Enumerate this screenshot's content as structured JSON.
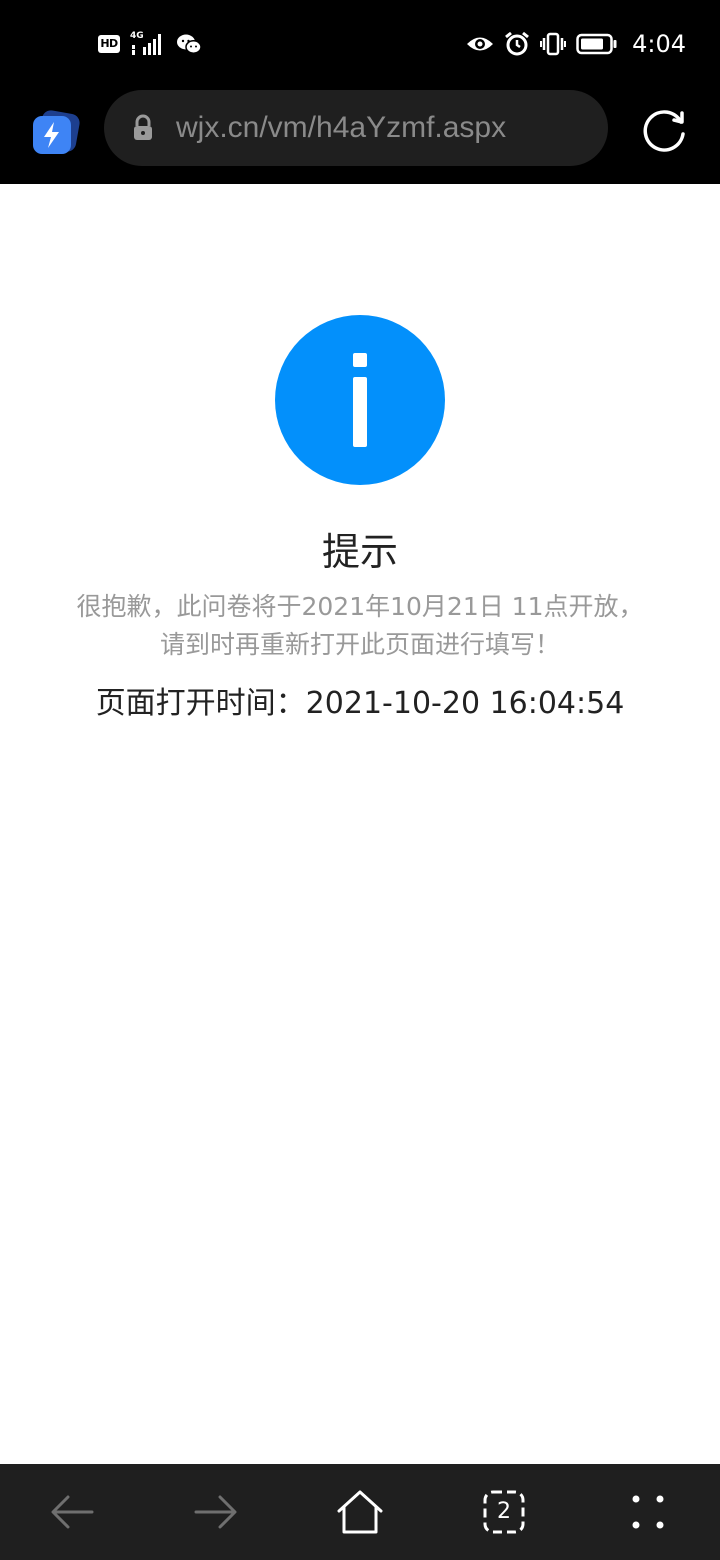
{
  "status_bar": {
    "hd_label": "HD",
    "network_label": "4G",
    "time": "4:04",
    "icons": [
      "signal-icon",
      "wechat-icon",
      "eye-comfort-icon",
      "alarm-icon",
      "vibrate-icon",
      "battery-icon"
    ]
  },
  "browser": {
    "url": "wjx.cn/vm/h4aYzmf.aspx",
    "icons": [
      "browser-logo-icon",
      "lock-icon",
      "reload-icon"
    ]
  },
  "page": {
    "title": "提示",
    "message_line1": "很抱歉，此问卷将于2021年10月21日 11点开放，",
    "message_line2": "请到时再重新打开此页面进行填写！",
    "open_time": "页面打开时间：2021-10-20 16:04:54",
    "accent_color": "#0390fb",
    "icon": "info-icon"
  },
  "bottom_nav": {
    "tab_count": "2",
    "icons": [
      "back-arrow-icon",
      "forward-arrow-icon",
      "home-icon",
      "tabs-icon",
      "more-icon"
    ]
  }
}
